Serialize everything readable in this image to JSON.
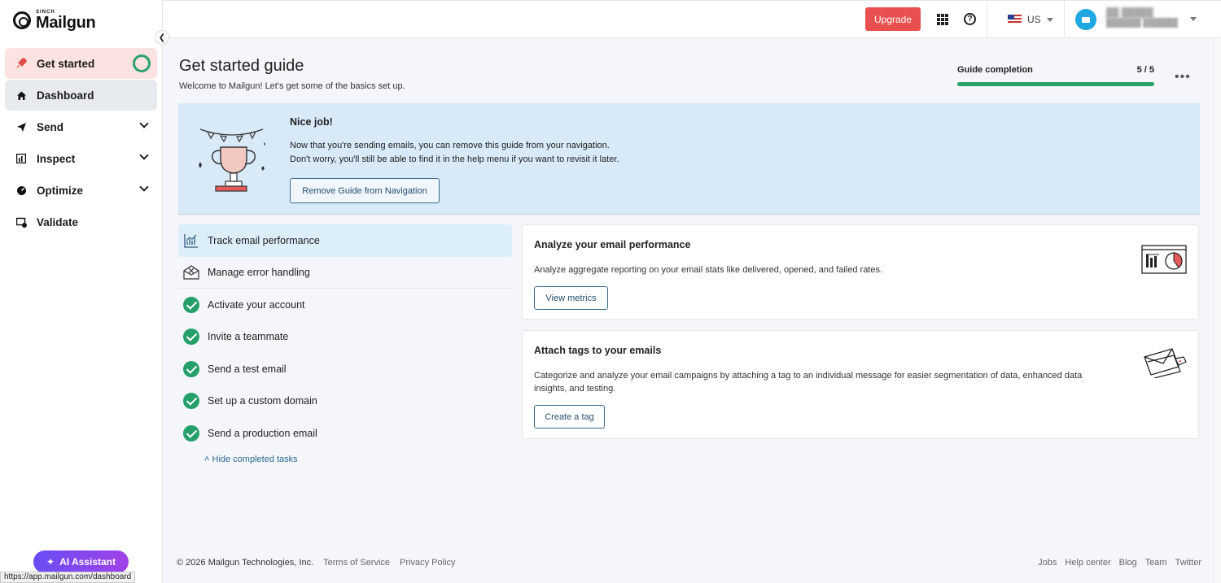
{
  "brand": {
    "sinch": "SINCH",
    "name": "Mailgun"
  },
  "sidebar": {
    "items": [
      {
        "label": "Get started",
        "icon": "rocket-icon"
      },
      {
        "label": "Dashboard",
        "icon": "home-icon"
      },
      {
        "label": "Send",
        "icon": "paper-plane-icon"
      },
      {
        "label": "Inspect",
        "icon": "report-icon"
      },
      {
        "label": "Optimize",
        "icon": "gauge-icon"
      },
      {
        "label": "Validate",
        "icon": "validate-icon"
      }
    ],
    "ai_assistant": "AI Assistant"
  },
  "status_url": "https://app.mailgun.com/dashboard",
  "topbar": {
    "upgrade": "Upgrade",
    "region": "US"
  },
  "header": {
    "title": "Get started guide",
    "subtitle": "Welcome to Mailgun! Let's get some of the basics set up.",
    "completion_label": "Guide completion",
    "completion_value": "5 / 5",
    "completion_fraction": 1.0
  },
  "banner": {
    "title": "Nice job!",
    "line1": "Now that you're sending emails, you can remove this guide from your navigation.",
    "line2": "Don't worry, you'll still be able to find it in the help menu if you want to revisit it later.",
    "button": "Remove Guide from Navigation"
  },
  "tasks": [
    {
      "label": "Track email performance",
      "state": "active"
    },
    {
      "label": "Manage error handling",
      "state": "open"
    },
    {
      "label": "Activate your account",
      "state": "done"
    },
    {
      "label": "Invite a teammate",
      "state": "done"
    },
    {
      "label": "Send a test email",
      "state": "done"
    },
    {
      "label": "Set up a custom domain",
      "state": "done"
    },
    {
      "label": "Send a production email",
      "state": "done"
    }
  ],
  "hide_completed": "Hide completed tasks",
  "cards": [
    {
      "title": "Analyze your email performance",
      "desc": "Analyze aggregate reporting on your email stats like delivered, opened, and failed rates.",
      "button": "View metrics"
    },
    {
      "title": "Attach tags to your emails",
      "desc": "Categorize and analyze your email campaigns by attaching a tag to an individual message for easier segmentation of data, enhanced data insights, and testing.",
      "button": "Create a tag"
    }
  ],
  "footer": {
    "copyright": "© 2026 Mailgun Technologies, Inc.",
    "terms": "Terms of Service",
    "privacy": "Privacy Policy",
    "links": [
      "Jobs",
      "Help center",
      "Blog",
      "Team",
      "Twitter"
    ]
  },
  "colors": {
    "accent_red": "#ea4f4f",
    "success_green": "#28a36a",
    "banner_blue": "#d8e9f8",
    "ai_purple": "#7b4df0"
  }
}
